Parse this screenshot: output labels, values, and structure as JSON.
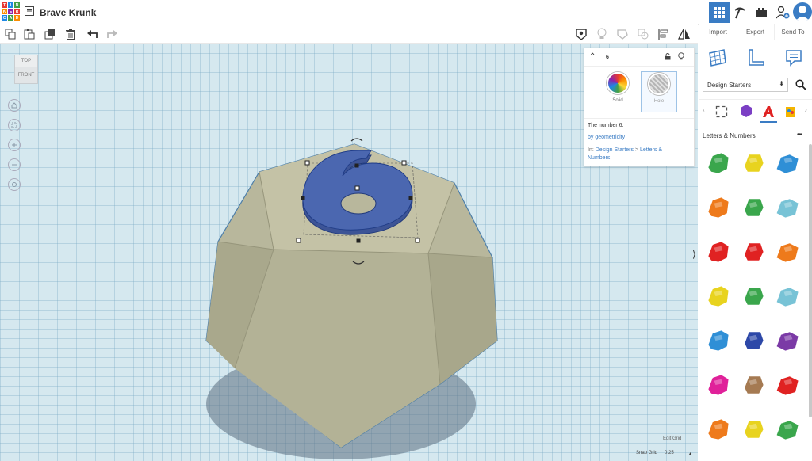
{
  "app": {
    "title": "Brave Krunk",
    "logo_letters": [
      "TIN",
      "KER",
      "CAD"
    ]
  },
  "right_tabs": [
    "Import",
    "Export",
    "Send To"
  ],
  "library": {
    "selected": "Design Starters",
    "category_title": "Letters & Numbers",
    "more": "•••"
  },
  "popup": {
    "name": "6",
    "solid_label": "Solid",
    "hole_label": "Hole",
    "description": "The number 6.",
    "author": "by geometricity",
    "path_prefix": "In:",
    "path_part1": "Design Starters",
    "path_sep": ">",
    "path_part2": "Letters &",
    "path_part3": "Numbers"
  },
  "viewcube": {
    "top": "TOP",
    "front": "FRONT"
  },
  "viewport": {
    "edit_grid": "Edit Grid",
    "snap_label": "Snap Grid",
    "snap_value": "0.25"
  },
  "colors": {
    "accent": "#3a7cc4",
    "shape_body": "#b8b79c",
    "six_fill": "#4b67b0",
    "grid_bg": "#d5e8ef"
  },
  "shapes": [
    {
      "icon": "letter-a-icon",
      "color": "#3aa64c"
    },
    {
      "icon": "letter-b-icon",
      "color": "#e8d31f"
    },
    {
      "icon": "letter-c-icon",
      "color": "#2f8fd6"
    },
    {
      "icon": "letter-d-icon",
      "color": "#ee7a1b"
    },
    {
      "icon": "letter-e-icon",
      "color": "#3aa64c"
    },
    {
      "icon": "letter-f-icon",
      "color": "#78c3d6"
    },
    {
      "icon": "letter-g-icon",
      "color": "#e02222"
    },
    {
      "icon": "letter-h-icon",
      "color": "#e02222"
    },
    {
      "icon": "letter-i-icon",
      "color": "#ee7a1b"
    },
    {
      "icon": "letter-j-icon",
      "color": "#e8d31f"
    },
    {
      "icon": "letter-k-icon",
      "color": "#3aa64c"
    },
    {
      "icon": "letter-l-icon",
      "color": "#78c3d6"
    },
    {
      "icon": "letter-m-icon",
      "color": "#2f8fd6"
    },
    {
      "icon": "letter-n-icon",
      "color": "#2d48a8"
    },
    {
      "icon": "letter-o-icon",
      "color": "#7b3aa6"
    },
    {
      "icon": "letter-p-icon",
      "color": "#e0219a"
    },
    {
      "icon": "letter-q-icon",
      "color": "#a57a52"
    },
    {
      "icon": "letter-r-icon",
      "color": "#e02222"
    },
    {
      "icon": "letter-s-icon",
      "color": "#ee7a1b"
    },
    {
      "icon": "letter-t-icon",
      "color": "#e8d31f"
    },
    {
      "icon": "letter-u-icon",
      "color": "#3aa64c"
    }
  ]
}
